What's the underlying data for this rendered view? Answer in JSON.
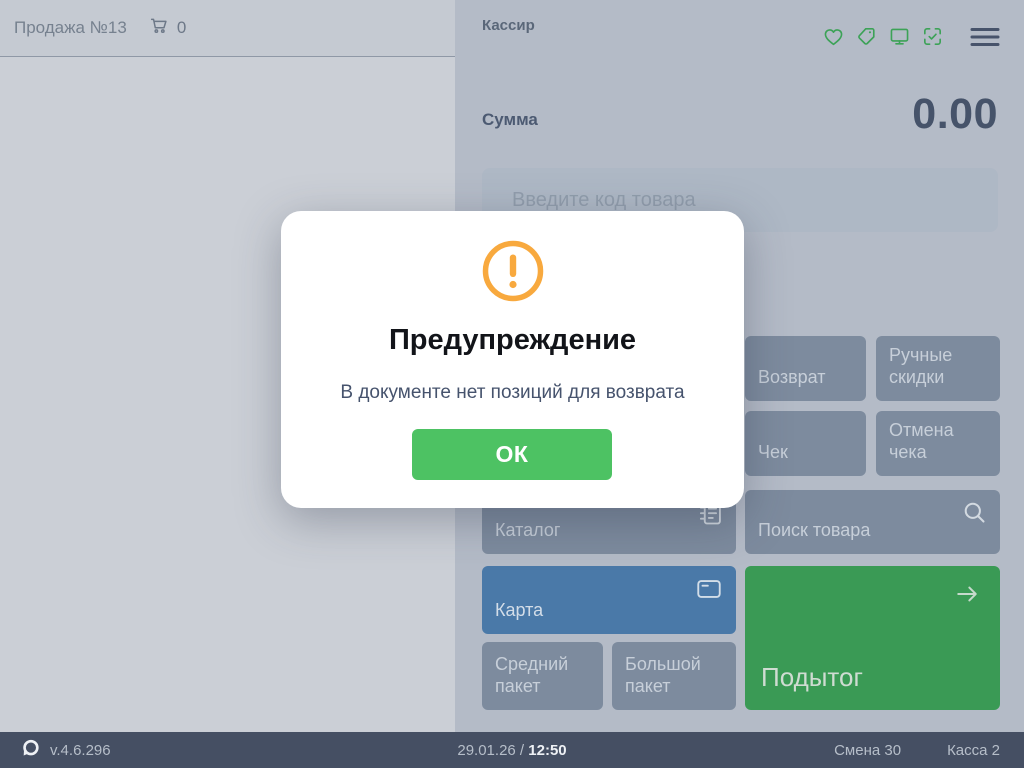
{
  "colors": {
    "accent_green": "#3ca257",
    "warning_orange": "#f8a93e",
    "ok_green": "#4dc263",
    "card_blue": "#4a79a8",
    "subtotal_green": "#3a9a55",
    "status_bar_bg": "#454f63"
  },
  "left_panel": {
    "title": "Продажа №13",
    "cart_icon": "cart-icon",
    "cart_count": "0"
  },
  "right_panel": {
    "cashier_label": "Кассир",
    "header_icons": [
      "heart-icon",
      "tag-icon",
      "display-icon",
      "scan-check-icon",
      "menu-icon"
    ],
    "sum_label": "Сумма",
    "sum_value": "0.00",
    "input": {
      "value": "",
      "placeholder": "Введите код товара"
    },
    "buttons": {
      "return": "Возврат",
      "manual_discounts": "Ручные скидки",
      "receipt": "Чек",
      "cancel_receipt": "Отмена чека",
      "catalog": "Каталог",
      "product_search": "Поиск товара",
      "card": "Карта",
      "medium_bag": "Средний пакет",
      "large_bag": "Большой пакет",
      "subtotal": "Подытог"
    }
  },
  "modal": {
    "icon": "warning-icon",
    "title": "Предупреждение",
    "message": "В документе нет позиций для возврата",
    "ok_label": "ОК"
  },
  "status_bar": {
    "version": "v.4.6.296",
    "date": "29.01.26",
    "separator": " / ",
    "time": "12:50",
    "shift": "Смена 30",
    "register": "Касса 2"
  }
}
